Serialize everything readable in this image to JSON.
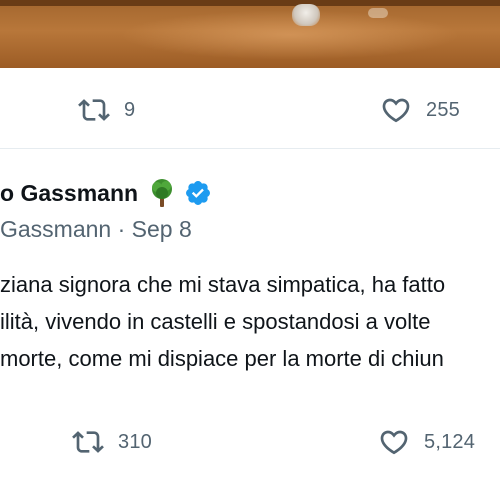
{
  "tweets": [
    {
      "actions": {
        "retweets": "9",
        "likes": "255"
      }
    },
    {
      "author": {
        "display_name": "o Gassmann",
        "handle_date": "Gassmann · Sep 8"
      },
      "text_lines": [
        "ziana signora che mi stava simpatica, ha fatto",
        "ilità, vivendo in castelli e spostandosi a volte",
        "morte, come mi dispiace per la morte di chiun"
      ],
      "actions": {
        "retweets": "310",
        "likes": "5,124"
      }
    }
  ],
  "icons": {
    "retweet": "retweet-icon",
    "like": "heart-icon",
    "emoji": "deciduous-tree-emoji",
    "verified": "verified-badge-icon"
  },
  "colors": {
    "text": "#0f1419",
    "secondary": "#536471",
    "verified": "#1d9bf0",
    "divider": "#e6ecf0"
  }
}
